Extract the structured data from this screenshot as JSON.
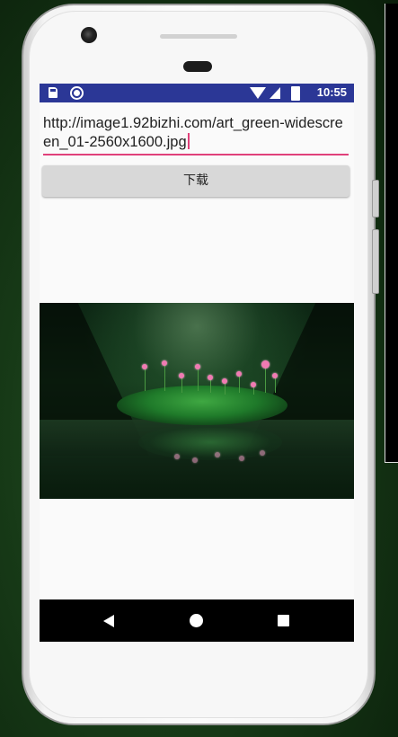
{
  "status_bar": {
    "time": "10:55",
    "icons": [
      "sd-card-icon",
      "circle-icon",
      "wifi-icon",
      "signal-icon",
      "battery-icon"
    ]
  },
  "url_input": {
    "value": "http://image1.92bizhi.com/art_green-widescreen_01-2560x1600.jpg"
  },
  "download_button": {
    "label": "下载"
  },
  "image": {
    "description_icon": "lotus-pond-image"
  },
  "nav_bar": {
    "icons": [
      "back-icon",
      "home-icon",
      "recent-apps-icon"
    ]
  },
  "colors": {
    "status_bar": "#2b3796",
    "accent": "#e0407a",
    "button_bg": "#d8d8d8",
    "nav_bar": "#000000"
  }
}
